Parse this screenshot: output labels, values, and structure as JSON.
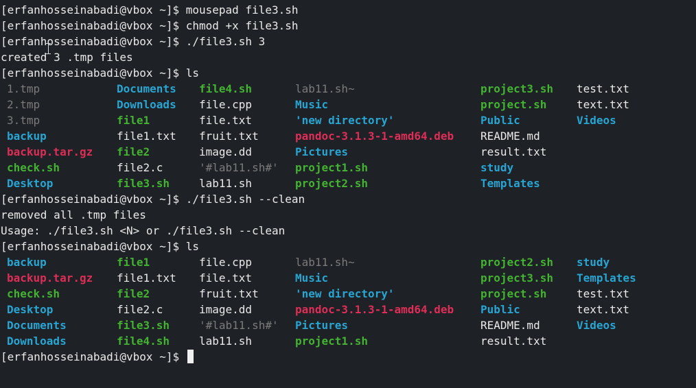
{
  "terminal": {
    "prompt": "[erfanhosseinabadi@vbox ~]$ ",
    "cmd1": "mousepad file3.sh",
    "cmd2": "chmod +x file3.sh",
    "cmd3": "./file3.sh 3",
    "out3": "created 3 .tmp files",
    "cmd4": "ls",
    "cmd5": "./file3.sh --clean",
    "out5a": "removed all .tmp files",
    "out5b": "Usage: ./file3.sh <N> or ./file3.sh --clean",
    "cmd6": "ls"
  },
  "ls1": [
    {
      "name": "1.tmp",
      "type": "tmp"
    },
    {
      "name": "Documents",
      "type": "dir"
    },
    {
      "name": "file4.sh",
      "type": "exec"
    },
    {
      "name": "lab11.sh~",
      "type": "hidden"
    },
    {
      "name": "project3.sh",
      "type": "exec"
    },
    {
      "name": "test.txt",
      "type": "file"
    },
    {
      "name": "2.tmp",
      "type": "tmp"
    },
    {
      "name": "Downloads",
      "type": "dir"
    },
    {
      "name": "file.cpp",
      "type": "file"
    },
    {
      "name": "Music",
      "type": "dir"
    },
    {
      "name": "project.sh",
      "type": "exec"
    },
    {
      "name": "text.txt",
      "type": "file"
    },
    {
      "name": "3.tmp",
      "type": "tmp"
    },
    {
      "name": "file1",
      "type": "exec"
    },
    {
      "name": "file.txt",
      "type": "file"
    },
    {
      "name": "'new directory'",
      "type": "dir"
    },
    {
      "name": "Public",
      "type": "dir"
    },
    {
      "name": "Videos",
      "type": "dir"
    },
    {
      "name": "backup",
      "type": "dir"
    },
    {
      "name": "file1.txt",
      "type": "file"
    },
    {
      "name": "fruit.txt",
      "type": "file"
    },
    {
      "name": "pandoc-3.1.3-1-amd64.deb",
      "type": "archive"
    },
    {
      "name": "README.md",
      "type": "file"
    },
    {
      "name": "",
      "type": "file"
    },
    {
      "name": "backup.tar.gz",
      "type": "archive"
    },
    {
      "name": "file2",
      "type": "exec"
    },
    {
      "name": "image.dd",
      "type": "file"
    },
    {
      "name": "Pictures",
      "type": "dir"
    },
    {
      "name": "result.txt",
      "type": "file"
    },
    {
      "name": "",
      "type": "file"
    },
    {
      "name": "check.sh",
      "type": "exec"
    },
    {
      "name": "file2.c",
      "type": "file"
    },
    {
      "name": "'#lab11.sh#'",
      "type": "hidden"
    },
    {
      "name": "project1.sh",
      "type": "exec"
    },
    {
      "name": "study",
      "type": "dir"
    },
    {
      "name": "",
      "type": "file"
    },
    {
      "name": "Desktop",
      "type": "dir"
    },
    {
      "name": "file3.sh",
      "type": "exec"
    },
    {
      "name": "lab11.sh",
      "type": "file"
    },
    {
      "name": "project2.sh",
      "type": "exec"
    },
    {
      "name": "Templates",
      "type": "dir"
    },
    {
      "name": "",
      "type": "file"
    }
  ],
  "ls2": [
    {
      "name": "backup",
      "type": "dir"
    },
    {
      "name": "file1",
      "type": "exec"
    },
    {
      "name": "file.cpp",
      "type": "file"
    },
    {
      "name": "lab11.sh~",
      "type": "hidden"
    },
    {
      "name": "project2.sh",
      "type": "exec"
    },
    {
      "name": "study",
      "type": "dir"
    },
    {
      "name": "backup.tar.gz",
      "type": "archive"
    },
    {
      "name": "file1.txt",
      "type": "file"
    },
    {
      "name": "file.txt",
      "type": "file"
    },
    {
      "name": "Music",
      "type": "dir"
    },
    {
      "name": "project3.sh",
      "type": "exec"
    },
    {
      "name": "Templates",
      "type": "dir"
    },
    {
      "name": "check.sh",
      "type": "exec"
    },
    {
      "name": "file2",
      "type": "exec"
    },
    {
      "name": "fruit.txt",
      "type": "file"
    },
    {
      "name": "'new directory'",
      "type": "dir"
    },
    {
      "name": "project.sh",
      "type": "exec"
    },
    {
      "name": "test.txt",
      "type": "file"
    },
    {
      "name": "Desktop",
      "type": "dir"
    },
    {
      "name": "file2.c",
      "type": "file"
    },
    {
      "name": "image.dd",
      "type": "file"
    },
    {
      "name": "pandoc-3.1.3-1-amd64.deb",
      "type": "archive"
    },
    {
      "name": "Public",
      "type": "dir"
    },
    {
      "name": "text.txt",
      "type": "file"
    },
    {
      "name": "Documents",
      "type": "dir"
    },
    {
      "name": "file3.sh",
      "type": "exec"
    },
    {
      "name": "'#lab11.sh#'",
      "type": "hidden"
    },
    {
      "name": "Pictures",
      "type": "dir"
    },
    {
      "name": "README.md",
      "type": "file"
    },
    {
      "name": "Videos",
      "type": "dir"
    },
    {
      "name": "Downloads",
      "type": "dir"
    },
    {
      "name": "file4.sh",
      "type": "exec"
    },
    {
      "name": "lab11.sh",
      "type": "file"
    },
    {
      "name": "project1.sh",
      "type": "exec"
    },
    {
      "name": "result.txt",
      "type": "file"
    },
    {
      "name": "",
      "type": "file"
    }
  ],
  "colors": {
    "background": "#1e2125",
    "text": "#eaeaea",
    "directory": "#27a5d3",
    "executable": "#43b331",
    "archive": "#dd2e57",
    "tmp_hidden": "#7b7b7b"
  }
}
